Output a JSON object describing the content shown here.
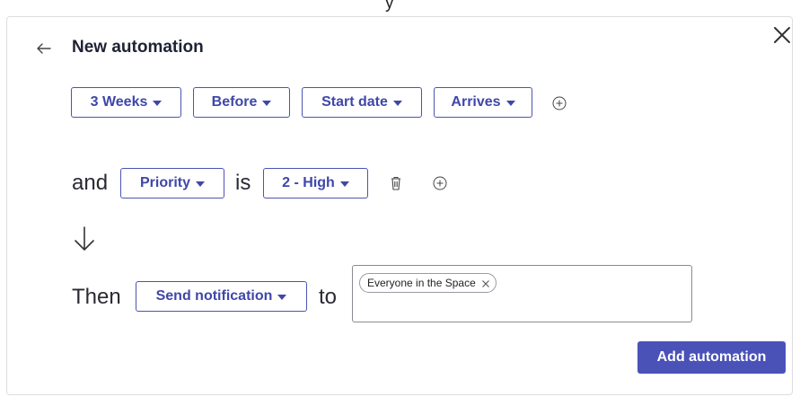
{
  "header": {
    "title": "New automation",
    "partial_text_above": "y"
  },
  "trigger": {
    "duration_label": "3 Weeks",
    "relation_label": "Before",
    "date_field_label": "Start date",
    "event_label": "Arrives"
  },
  "condition": {
    "connector": "and",
    "field_label": "Priority",
    "operator": "is",
    "value_label": "2 - High"
  },
  "action": {
    "connector": "Then",
    "action_label": "Send notification",
    "to_label": "to",
    "recipients": [
      {
        "label": "Everyone in the Space"
      }
    ]
  },
  "footer": {
    "submit_label": "Add automation"
  },
  "icons": {
    "back": "arrow-left-icon",
    "close": "close-icon",
    "add": "plus-circle-icon",
    "delete": "trash-icon",
    "flow": "arrow-down-icon",
    "caret": "caret-down-icon",
    "chip_remove": "close-icon"
  },
  "colors": {
    "accent": "#4a52b8",
    "pill_text": "#3f47a8",
    "text": "#1f2233"
  }
}
